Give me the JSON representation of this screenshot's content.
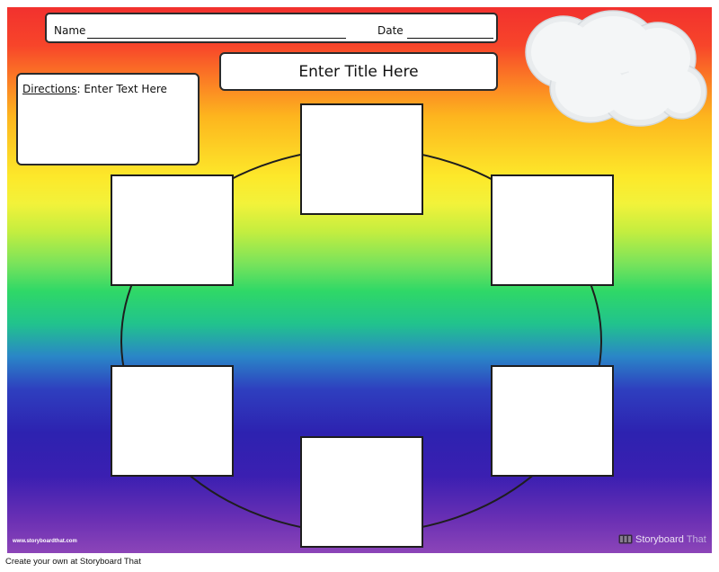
{
  "header": {
    "name_label": "Name",
    "date_label": "Date"
  },
  "title_box": {
    "text": "Enter Title Here"
  },
  "directions": {
    "label": "Directions",
    "text": ": Enter Text Here"
  },
  "watermark": {
    "url": "www.storyboardthat.com"
  },
  "logo": {
    "brand_first": "Storyboard",
    "brand_second": "That"
  },
  "footer": {
    "text": "Create your own at Storyboard That"
  },
  "colors": {
    "gradient": [
      "#f2312e",
      "#fb7a25",
      "#fde82a",
      "#2fd867",
      "#2e3fbf",
      "#8c45b8"
    ],
    "box_fill": "#ffffff",
    "stroke": "#1e1e1e"
  },
  "diagram": {
    "type": "cycle",
    "box_count": 6,
    "icon": "cloud-icon"
  }
}
